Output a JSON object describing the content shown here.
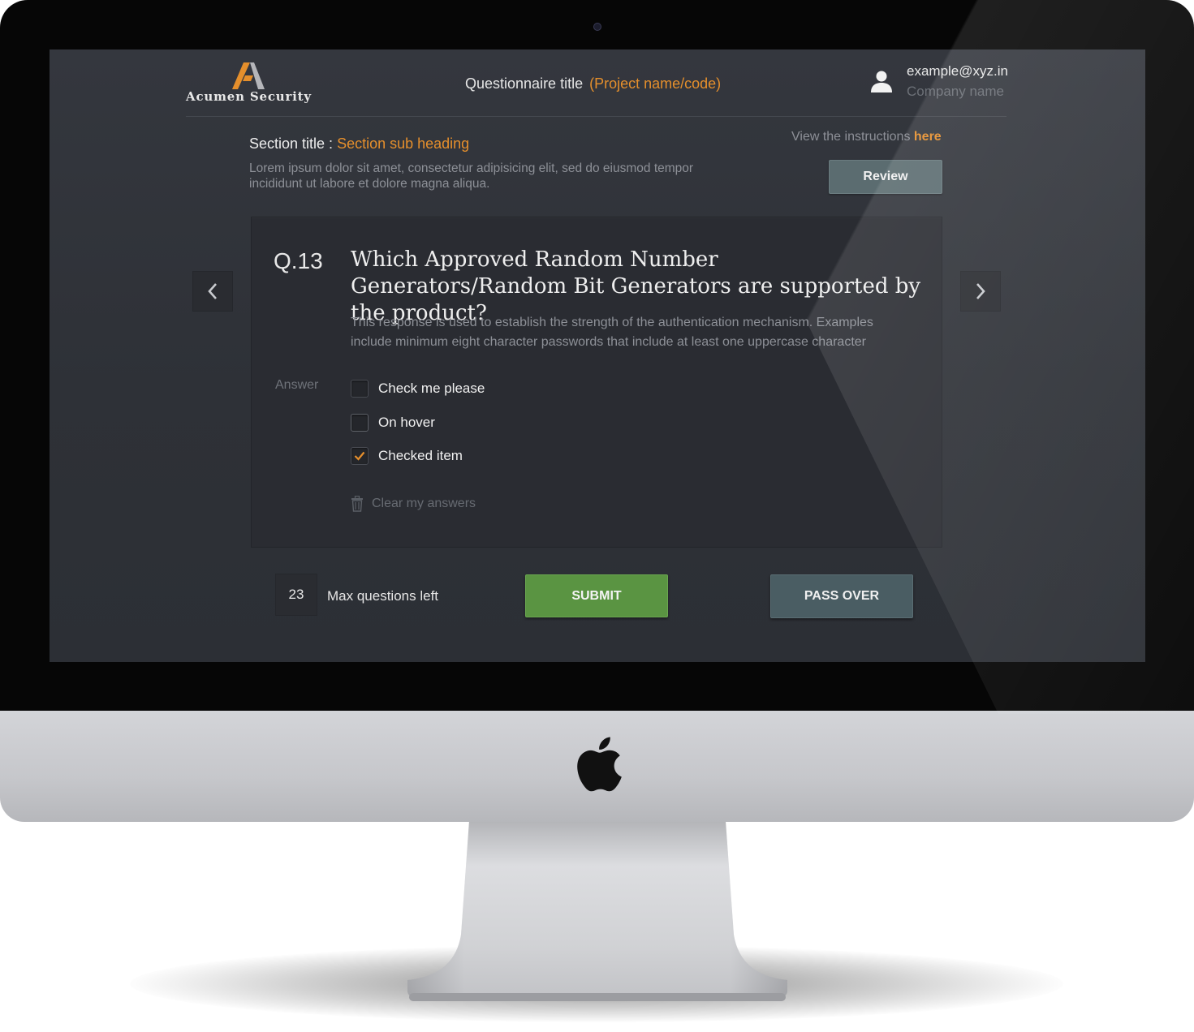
{
  "header": {
    "brand": "Acumen Security",
    "questionnaire_title": "Questionnaire title",
    "project": "(Project name/code)",
    "user_email": "example@xyz.in",
    "company": "Company name"
  },
  "section": {
    "title_prefix": "Section title : ",
    "sub_heading": "Section sub heading",
    "description": "Lorem ipsum dolor sit amet, consectetur adipisicing elit, sed do eiusmod tempor incididunt ut labore et dolore magna aliqua.",
    "instructions_text": "View the instructions ",
    "instructions_link": "here",
    "review_label": "Review"
  },
  "question": {
    "number": "Q.13",
    "text": "Which Approved Random Number Generators/Random Bit Generators are supported by the product?",
    "help": "This response is used to establish the strength of the authentication mechanism. Examples include minimum eight character passwords that include at least one uppercase character",
    "answer_label": "Answer",
    "options": [
      {
        "label": "Check me please",
        "checked": false
      },
      {
        "label": "On hover",
        "checked": false
      },
      {
        "label": "Checked item",
        "checked": true
      }
    ],
    "clear_label": "Clear my answers"
  },
  "footer": {
    "questions_left": "23",
    "questions_left_label": "Max questions left",
    "submit_label": "SUBMIT",
    "pass_label": "PASS OVER"
  },
  "colors": {
    "accent": "#e58f2c",
    "submit": "#5a9442",
    "pass_over": "#4a5d63",
    "review": "#5b6c70",
    "screen_bg": "#2e3137"
  },
  "icons": [
    "prev-chevron-icon",
    "next-chevron-icon",
    "user-icon",
    "trash-icon",
    "checkmark-icon",
    "apple-logo-icon"
  ]
}
